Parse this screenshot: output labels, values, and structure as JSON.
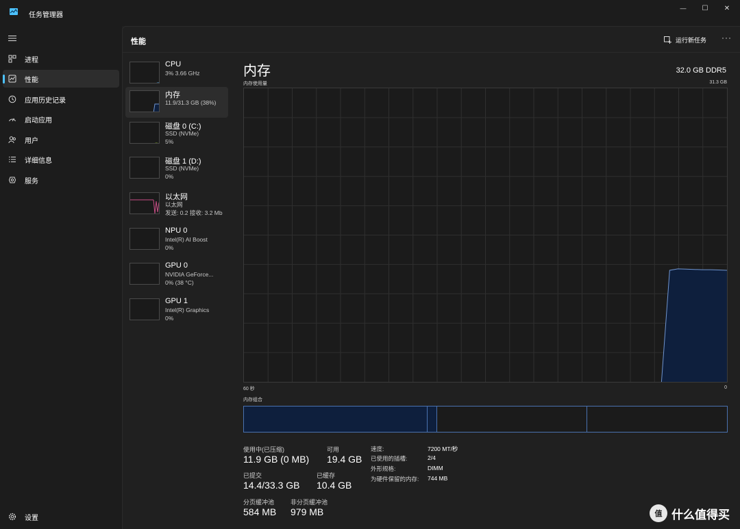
{
  "window": {
    "title": "任务管理器",
    "minimize_glyph": "—",
    "maximize_glyph": "☐",
    "close_glyph": "✕"
  },
  "sidebar": {
    "items": [
      {
        "label": "进程",
        "icon": "processes-icon"
      },
      {
        "label": "性能",
        "icon": "performance-icon",
        "active": true
      },
      {
        "label": "应用历史记录",
        "icon": "app-history-icon"
      },
      {
        "label": "启动应用",
        "icon": "startup-apps-icon"
      },
      {
        "label": "用户",
        "icon": "users-icon"
      },
      {
        "label": "详细信息",
        "icon": "details-icon"
      },
      {
        "label": "服务",
        "icon": "services-icon"
      }
    ],
    "settings_label": "设置"
  },
  "header": {
    "title": "性能",
    "run_task_label": "运行新任务",
    "more_label": "···"
  },
  "devices": [
    {
      "name": "CPU",
      "line2": "3% 3.66 GHz",
      "line3": ""
    },
    {
      "name": "内存",
      "line2": "11.9/31.3 GB (38%)",
      "line3": "",
      "active": true
    },
    {
      "name": "磁盘 0 (C:)",
      "line2": "SSD (NVMe)",
      "line3": "5%"
    },
    {
      "name": "磁盘 1 (D:)",
      "line2": "SSD (NVMe)",
      "line3": "0%"
    },
    {
      "name": "以太网",
      "line2": "以太网",
      "line3": "发送: 0.2 接收: 3.2 Mb"
    },
    {
      "name": "NPU 0",
      "line2": "Intel(R) AI Boost",
      "line3": "0%"
    },
    {
      "name": "GPU 0",
      "line2": "NVIDIA GeForce...",
      "line3": "0% (38 °C)"
    },
    {
      "name": "GPU 1",
      "line2": "Intel(R) Graphics",
      "line3": "0%"
    }
  ],
  "detail": {
    "title": "内存",
    "spec": "32.0 GB DDR5",
    "usage_label": "内存使用量",
    "max_label": "31.3 GB",
    "time_left_label": "60 秒",
    "time_right_label": "0",
    "composition_label": "内存组合",
    "colors": {
      "accent": "#4a72b0",
      "fill": "#0e1f3d",
      "graph_line": "#6f94cf"
    },
    "usage_fraction_history": [
      0,
      0,
      0,
      0,
      0,
      0,
      0,
      0,
      0,
      0,
      0,
      0,
      0,
      0,
      0,
      0,
      0,
      0,
      0,
      0,
      0,
      0,
      0,
      0,
      0,
      0,
      0,
      0,
      0,
      0,
      0,
      0,
      0,
      0,
      0,
      0,
      0,
      0,
      0,
      0,
      0,
      0,
      0,
      0,
      0,
      0,
      0,
      0,
      0,
      0,
      0,
      0,
      0.38,
      0.385,
      0.384,
      0.383,
      0.382,
      0.382,
      0.381,
      0.38
    ],
    "composition": {
      "in_use": 0.38,
      "modified": 0.02,
      "standby": 0.31,
      "free": 0.29
    }
  },
  "stats": {
    "in_use_label": "使用中(已压缩)",
    "in_use_value": "11.9 GB (0 MB)",
    "available_label": "可用",
    "available_value": "19.4 GB",
    "committed_label": "已提交",
    "committed_value": "14.4/33.3 GB",
    "cached_label": "已缓存",
    "cached_value": "10.4 GB",
    "paged_label": "分页缓冲池",
    "paged_value": "584 MB",
    "nonpaged_label": "非分页缓冲池",
    "nonpaged_value": "979 MB",
    "speed_key": "速度:",
    "speed_val": "7200 MT/秒",
    "slots_key": "已使用的插槽:",
    "slots_val": "2/4",
    "form_key": "外形规格:",
    "form_val": "DIMM",
    "reserved_key": "为硬件保留的内存:",
    "reserved_val": "744 MB"
  },
  "watermark": {
    "badge": "值",
    "text": "什么值得买"
  }
}
